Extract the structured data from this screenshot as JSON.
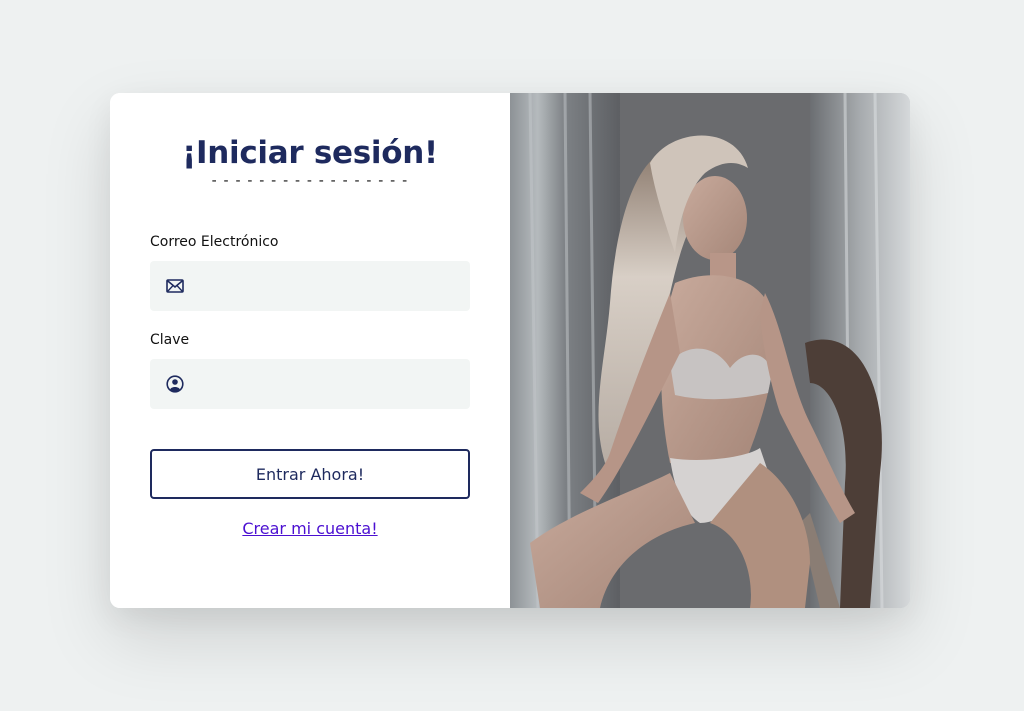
{
  "login": {
    "title": "¡Iniciar sesión!",
    "title_underline": "- - - - - - - - - - - - - - - - -",
    "email_label": "Correo Electrónico",
    "email_value": "",
    "email_icon": "envelope-icon",
    "password_label": "Clave",
    "password_value": "",
    "password_icon": "user-circle-icon",
    "submit_label": "Entrar Ahora!",
    "create_account_label": "Crear mi cuenta!"
  },
  "colors": {
    "page_background": "#eef1f1",
    "primary": "#1e2a5e",
    "link": "#4b0fd1",
    "field_background": "#f2f5f4"
  }
}
